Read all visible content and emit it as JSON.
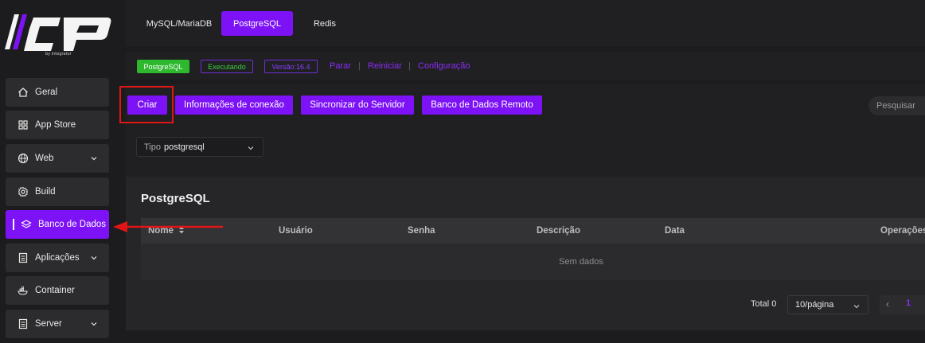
{
  "logo": {
    "sub": "by integrator"
  },
  "sidebar": {
    "items": [
      {
        "label": "Geral",
        "icon": "home-icon"
      },
      {
        "label": "App Store",
        "icon": "grid-icon"
      },
      {
        "label": "Web",
        "icon": "globe-icon"
      },
      {
        "label": "Build",
        "icon": "gear-icon"
      },
      {
        "label": "Banco de Dados",
        "icon": "layers-icon",
        "active": true
      },
      {
        "label": "Aplicações",
        "icon": "document-icon"
      },
      {
        "label": "Container",
        "icon": "docker-icon"
      },
      {
        "label": "Server",
        "icon": "document-icon"
      }
    ]
  },
  "tabs": [
    "MySQL/MariaDB",
    "PostgreSQL",
    "Redis"
  ],
  "status": {
    "name": "PostgreSQL",
    "state": "Executando",
    "version": "Versão:16.4",
    "actions": [
      "Parar",
      "Reiniciar",
      "Configuração"
    ]
  },
  "toolbar": {
    "create": "Criar",
    "connection_info": "Informações de conexão",
    "sync": "Sincronizar do Servidor",
    "remote": "Banco de Dados Remoto",
    "search_placeholder": "Pesquisar"
  },
  "filter": {
    "label": "Tipo",
    "value": "postgresql"
  },
  "table": {
    "title": "PostgreSQL",
    "columns": [
      "Nome",
      "Usuário",
      "Senha",
      "Descrição",
      "Data",
      "Operações"
    ],
    "empty": "Sem dados"
  },
  "pagination": {
    "total": "Total 0",
    "page_size": "10/página",
    "current": "1"
  },
  "colors": {
    "accent": "#7c12f5",
    "running": "#2eb82e",
    "highlight": "#e01616"
  }
}
